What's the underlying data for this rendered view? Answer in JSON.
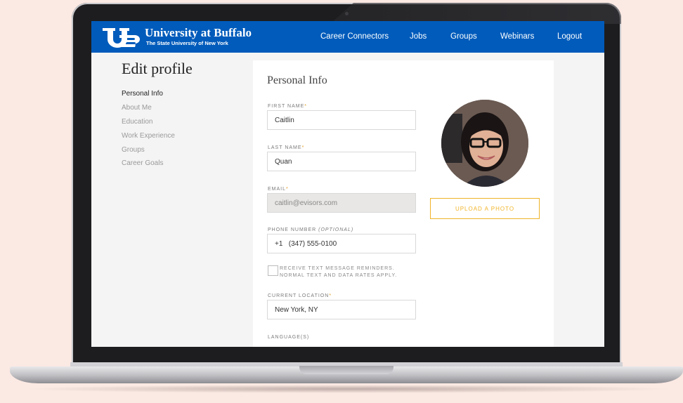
{
  "brand": {
    "name": "University at Buffalo",
    "subtitle": "The State University of New York"
  },
  "nav": {
    "items": [
      "Career Connectors",
      "Jobs",
      "Groups",
      "Webinars",
      "Logout"
    ]
  },
  "sidebar": {
    "title": "Edit profile",
    "items": [
      {
        "label": "Personal Info",
        "active": true
      },
      {
        "label": "About Me",
        "active": false
      },
      {
        "label": "Education",
        "active": false
      },
      {
        "label": "Work Experience",
        "active": false
      },
      {
        "label": "Groups",
        "active": false
      },
      {
        "label": "Career Goals",
        "active": false
      }
    ]
  },
  "form": {
    "section_title": "Personal Info",
    "first_name": {
      "label": "FIRST NAME",
      "required": "*",
      "value": "Caitlin"
    },
    "last_name": {
      "label": "LAST NAME",
      "required": "*",
      "value": "Quan"
    },
    "email": {
      "label": "EMAIL",
      "required": "*",
      "value": "caitlin@evisors.com"
    },
    "phone": {
      "label": "PHONE NUMBER",
      "optional": "(OPTIONAL)",
      "country_code": "+1",
      "value": "(347) 555-0100"
    },
    "sms_optin": {
      "line1": "RECEIVE TEXT MESSAGE REMINDERS.",
      "line2": "NORMAL TEXT AND DATA RATES APPLY.",
      "checked": false
    },
    "location": {
      "label": "CURRENT LOCATION",
      "required": "*",
      "value": "New York, NY"
    },
    "languages": {
      "label": "LANGUAGE(S)"
    },
    "upload_label": "UPLOAD A PHOTO"
  },
  "colors": {
    "header": "#005bbb",
    "accent": "#f0b429",
    "background": "#fbe9e3"
  }
}
